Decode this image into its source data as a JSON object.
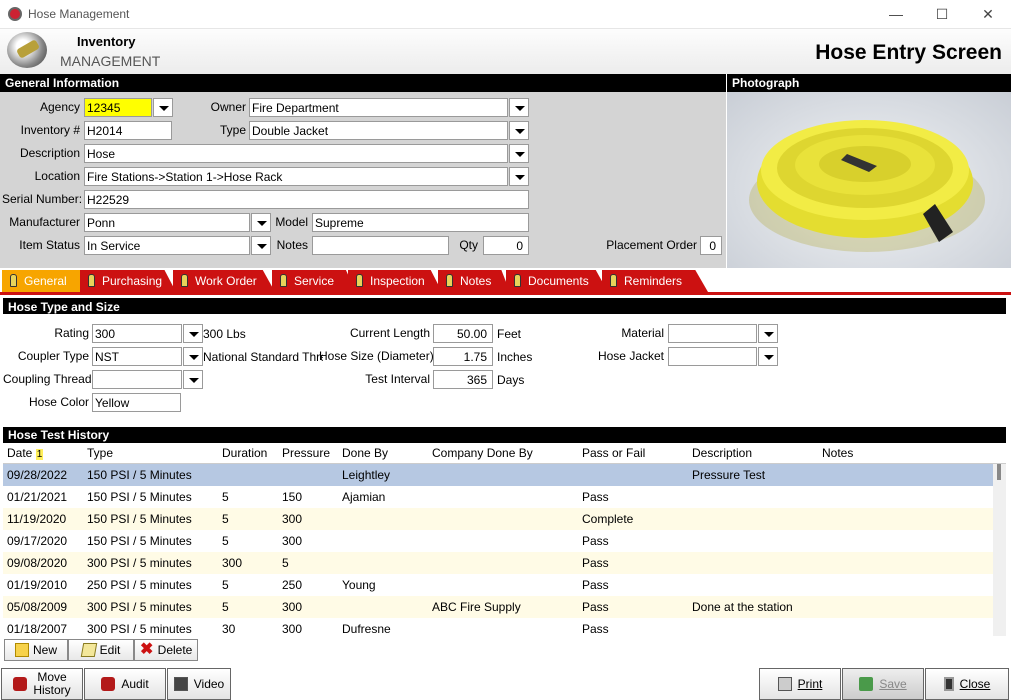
{
  "window": {
    "title": "Hose Management",
    "minimize": "—",
    "maximize": "☐",
    "close": "✕"
  },
  "header": {
    "inventory": "Inventory",
    "management": "MANAGEMENT",
    "screen_title": "Hose Entry Screen"
  },
  "general_info": {
    "title": "General Information",
    "agency_label": "Agency",
    "agency": "12345",
    "owner_label": "Owner",
    "owner": "Fire Department",
    "inventory_label": "Inventory #",
    "inventory": "H2014",
    "type_label": "Type",
    "type": "Double Jacket",
    "description_label": "Description",
    "description": "Hose",
    "location_label": "Location",
    "location": "Fire Stations->Station 1->Hose Rack",
    "serial_label": "Serial Number:",
    "serial": "H22529",
    "manufacturer_label": "Manufacturer",
    "manufacturer": "Ponn",
    "model_label": "Model",
    "model": "Supreme",
    "status_label": "Item Status",
    "status": "In Service",
    "notes_label": "Notes",
    "notes": "",
    "qty_label": "Qty",
    "qty": "0",
    "placement_label": "Placement Order",
    "placement": "0"
  },
  "photo": {
    "title": "Photograph"
  },
  "tabs": [
    "General",
    "Purchasing",
    "Work Order",
    "Service",
    "Inspection",
    "Notes",
    "Documents",
    "Reminders"
  ],
  "hose_type": {
    "title": "Hose Type and Size",
    "rating_label": "Rating",
    "rating": "300",
    "rating_unit": "300 Lbs",
    "coupler_label": "Coupler Type",
    "coupler": "NST",
    "coupler_desc": "National Standard Threac",
    "thread_label": "Coupling Thread",
    "thread": "",
    "color_label": "Hose Color",
    "color": "Yellow",
    "length_label": "Current Length",
    "length": "50.00",
    "length_unit": "Feet",
    "size_label": "Hose Size (Diameter)",
    "size": "1.75",
    "size_unit": "Inches",
    "interval_label": "Test Interval",
    "interval": "365",
    "interval_unit": "Days",
    "material_label": "Material",
    "material": "",
    "jacket_label": "Hose Jacket",
    "jacket": ""
  },
  "history": {
    "title": "Hose Test History",
    "sort_marker": "1",
    "columns": [
      "Date",
      "Type",
      "Duration",
      "Pressure",
      "Done By",
      "Company Done By",
      "Pass or Fail",
      "Description",
      "Notes"
    ],
    "rows": [
      [
        "09/28/2022",
        "150 PSI / 5 Minutes",
        "",
        "",
        "Leightley",
        "",
        "",
        "Pressure Test",
        ""
      ],
      [
        "01/21/2021",
        "150 PSI / 5 Minutes",
        "5",
        "150",
        "Ajamian",
        "",
        "Pass",
        "",
        ""
      ],
      [
        "11/19/2020",
        "150 PSI / 5 Minutes",
        "5",
        "300",
        "",
        "",
        "Complete",
        "",
        ""
      ],
      [
        "09/17/2020",
        "150 PSI / 5 Minutes",
        "5",
        "300",
        "",
        "",
        "Pass",
        "",
        ""
      ],
      [
        "09/08/2020",
        "300 PSI / 5 minutes",
        "300",
        "5",
        "",
        "",
        "Pass",
        "",
        ""
      ],
      [
        "01/19/2010",
        "250 PSI / 5 minutes",
        "5",
        "250",
        "Young",
        "",
        "Pass",
        "",
        ""
      ],
      [
        "05/08/2009",
        "300 PSI / 5 minutes",
        "5",
        "300",
        "",
        "ABC Fire Supply",
        "Pass",
        "Done at the station",
        ""
      ],
      [
        "01/18/2007",
        "300 PSI / 5 minutes",
        "30",
        "300",
        "Dufresne",
        "",
        "Pass",
        "",
        ""
      ]
    ]
  },
  "grid_buttons": {
    "new": "New",
    "edit": "Edit",
    "delete": "Delete"
  },
  "footer": {
    "move_history_1": "Move",
    "move_history_2": "History",
    "audit": "Audit",
    "video": "Video",
    "print": "Print",
    "save": "Save",
    "close": "Close"
  }
}
